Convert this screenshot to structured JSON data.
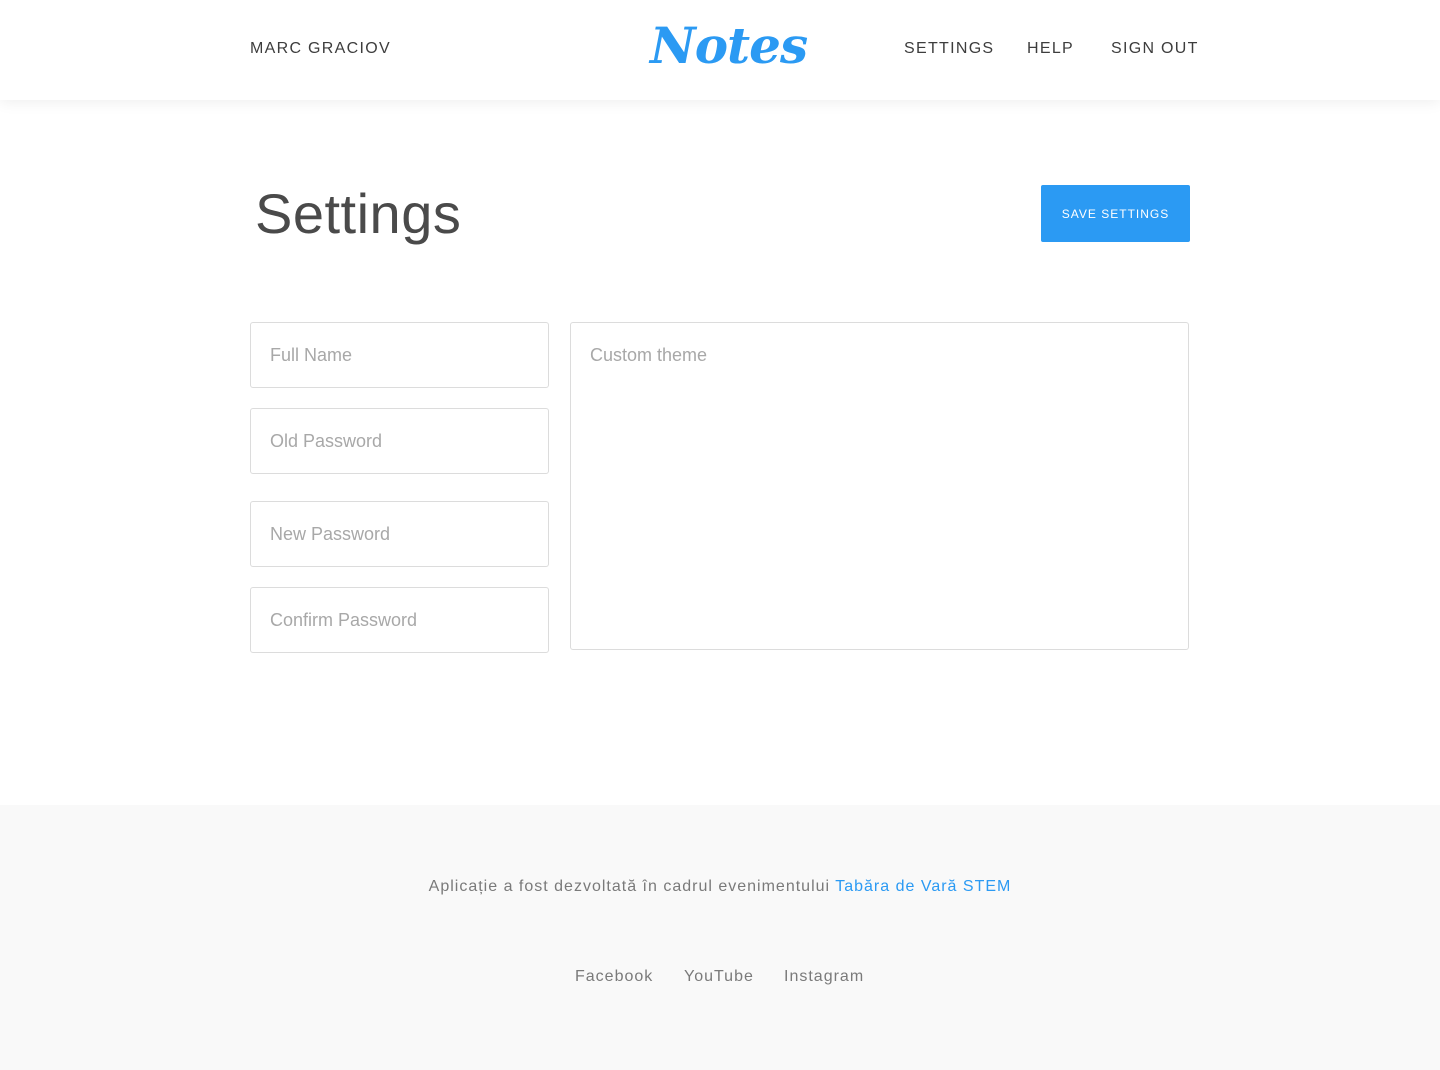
{
  "header": {
    "user_name": "MARC GRACIOV",
    "logo_text": "Notes",
    "nav": {
      "settings": "SETTINGS",
      "help": "HELP",
      "sign_out": "SIGN OUT"
    }
  },
  "main": {
    "title": "Settings",
    "save_button": "SAVE SETTINGS",
    "fields": {
      "full_name": {
        "placeholder": "Full Name",
        "value": ""
      },
      "old_password": {
        "placeholder": "Old Password",
        "value": ""
      },
      "new_password": {
        "placeholder": "New Password",
        "value": ""
      },
      "confirm_password": {
        "placeholder": "Confirm Password",
        "value": ""
      },
      "custom_theme": {
        "placeholder": "Custom theme",
        "value": ""
      }
    }
  },
  "footer": {
    "credit_text": "Aplicație a fost dezvoltată în cadrul evenimentului",
    "credit_link": "Tabăra de Vară STEM",
    "social": {
      "facebook": "Facebook",
      "youtube": "YouTube",
      "instagram": "Instagram"
    }
  },
  "colors": {
    "accent": "#2b9af3",
    "footer_background": "#f9f9f9"
  }
}
